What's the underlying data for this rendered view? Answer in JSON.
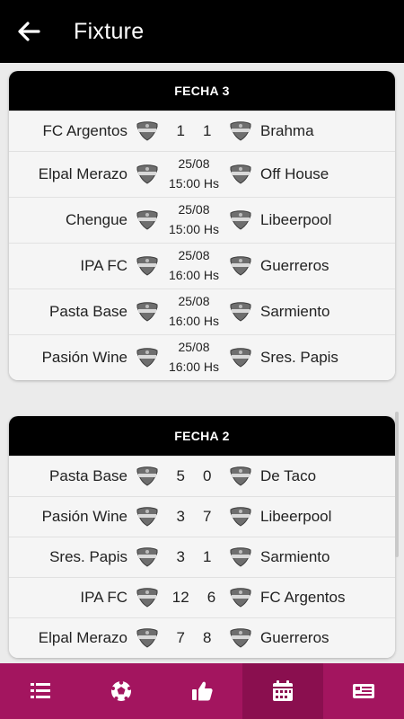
{
  "app": {
    "title": "Fixture"
  },
  "rounds": [
    {
      "title": "FECHA 3",
      "matches": [
        {
          "home": "FC Argentos",
          "away": "Brahma",
          "home_score": "1",
          "away_score": "1"
        },
        {
          "home": "Elpal Merazo",
          "away": "Off House",
          "date": "25/08",
          "time": "15:00 Hs"
        },
        {
          "home": "Chengue",
          "away": "Libeerpool",
          "date": "25/08",
          "time": "15:00 Hs"
        },
        {
          "home": "IPA FC",
          "away": "Guerreros",
          "date": "25/08",
          "time": "16:00 Hs"
        },
        {
          "home": "Pasta Base",
          "away": "Sarmiento",
          "date": "25/08",
          "time": "16:00 Hs"
        },
        {
          "home": "Pasión Wine",
          "away": "Sres. Papis",
          "date": "25/08",
          "time": "16:00 Hs"
        }
      ]
    },
    {
      "title": "FECHA 2",
      "matches": [
        {
          "home": "Pasta Base",
          "away": "De Taco",
          "home_score": "5",
          "away_score": "0"
        },
        {
          "home": "Pasión Wine",
          "away": "Libeerpool",
          "home_score": "3",
          "away_score": "7"
        },
        {
          "home": "Sres. Papis",
          "away": "Sarmiento",
          "home_score": "3",
          "away_score": "1"
        },
        {
          "home": "IPA FC",
          "away": "FC Argentos",
          "home_score": "12",
          "away_score": "6"
        },
        {
          "home": "Elpal Merazo",
          "away": "Guerreros",
          "home_score": "7",
          "away_score": "8"
        }
      ]
    }
  ],
  "nav": {
    "items": [
      {
        "icon": "standings-list-icon"
      },
      {
        "icon": "soccer-ball-icon"
      },
      {
        "icon": "thumbs-up-icon"
      },
      {
        "icon": "calendar-icon",
        "active": true
      },
      {
        "icon": "ticket-icon"
      }
    ]
  },
  "colors": {
    "appbar": "#000000",
    "nav": "#a3155f",
    "nav_active": "#8a0f4f",
    "background": "#ebebeb"
  }
}
